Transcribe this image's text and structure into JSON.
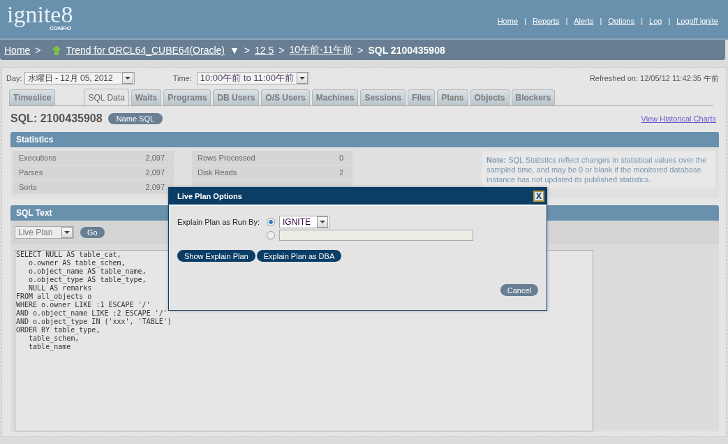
{
  "header": {
    "logo": "ignite8",
    "logo_sub": "CONFIO",
    "links": [
      {
        "kind": "link",
        "text": "Home"
      },
      {
        "kind": "sep",
        "text": "|"
      },
      {
        "kind": "link",
        "text": "Reports"
      },
      {
        "kind": "sep",
        "text": "|"
      },
      {
        "kind": "link",
        "text": "Alerts"
      },
      {
        "kind": "sep",
        "text": "|"
      },
      {
        "kind": "link",
        "text": "Options"
      },
      {
        "kind": "sep",
        "text": "|"
      },
      {
        "kind": "link",
        "text": "Log"
      },
      {
        "kind": "sep",
        "text": "|"
      },
      {
        "kind": "link",
        "text": "Logoff ignite"
      }
    ]
  },
  "breadcrumb": [
    {
      "kind": "link",
      "text": "Home"
    },
    {
      "kind": "sep",
      "text": ">"
    },
    {
      "kind": "trend",
      "text": "Trend for ORCL64_CUBE64(Oracle)"
    },
    {
      "kind": "caret",
      "text": "▼"
    },
    {
      "kind": "sep",
      "text": ">"
    },
    {
      "kind": "link",
      "text": "12 5"
    },
    {
      "kind": "sep",
      "text": ">"
    },
    {
      "kind": "link",
      "text": "10午前-11午前"
    },
    {
      "kind": "sep",
      "text": ">"
    },
    {
      "kind": "current",
      "text": "SQL 2100435908"
    }
  ],
  "filters": {
    "day_label": "Day:",
    "day_value": "水曜日 - 12月 05, 2012",
    "time_label": "Time:",
    "time_value": "10:00午前 to 11:00午前",
    "refreshed": "Refreshed on: 12/05/12 11:42:35 午前"
  },
  "tabs": [
    {
      "label": "Timeslice",
      "selected": false
    },
    {
      "label": "SQL Data",
      "selected": true
    },
    {
      "label": "Waits",
      "selected": false
    },
    {
      "label": "Programs",
      "selected": false
    },
    {
      "label": "DB Users",
      "selected": false
    },
    {
      "label": "O/S Users",
      "selected": false
    },
    {
      "label": "Machines",
      "selected": false
    },
    {
      "label": "Sessions",
      "selected": false
    },
    {
      "label": "Files",
      "selected": false
    },
    {
      "label": "Plans",
      "selected": false
    },
    {
      "label": "Objects",
      "selected": false
    },
    {
      "label": "Blockers",
      "selected": false
    }
  ],
  "sql_title": "SQL: 2100435908",
  "name_button": "Name SQL",
  "historical_link": "View Historical Charts",
  "statistics": {
    "title": "Statistics",
    "left": [
      {
        "label": "Executions",
        "value": "2,097"
      },
      {
        "label": "Parses",
        "value": "2,097"
      },
      {
        "label": "Sorts",
        "value": "2,097"
      }
    ],
    "right": [
      {
        "label": "Rows Processed",
        "value": "0"
      },
      {
        "label": "Disk Reads",
        "value": "2"
      }
    ],
    "note": "**Note:** SQL Statistics reflect changes in statistical values over the sampled time, and may be 0 or blank if the monitored database instance has not updated its published statistics."
  },
  "sql_text": {
    "title": "SQL Text",
    "plan_select": "Live Plan",
    "go_button": "Go",
    "lines": [
      "SELECT NULL AS table_cat,",
      "   o.owner AS table_schem,",
      "   o.object_name AS table_name,",
      "   o.object_type AS table_type,",
      "   NULL AS remarks",
      "FROM all_objects o",
      "WHERE o.owner LIKE :1 ESCAPE '/'",
      "AND o.object_name LIKE :2 ESCAPE '/'",
      "AND o.object_type IN ('xxx', 'TABLE')",
      "ORDER BY table_type,",
      "   table_schem,",
      "   table_name"
    ]
  },
  "dialog": {
    "title": "Live Plan Options",
    "close": "X",
    "run_by_label": "Explain Plan as Run By:",
    "options": [
      {
        "kind": "select",
        "value": "IGNITE",
        "selected": true
      },
      {
        "kind": "text",
        "selected": false
      }
    ],
    "buttons": [
      "Show Explain Plan",
      "Explain Plan as DBA"
    ],
    "cancel": "Cancel"
  }
}
